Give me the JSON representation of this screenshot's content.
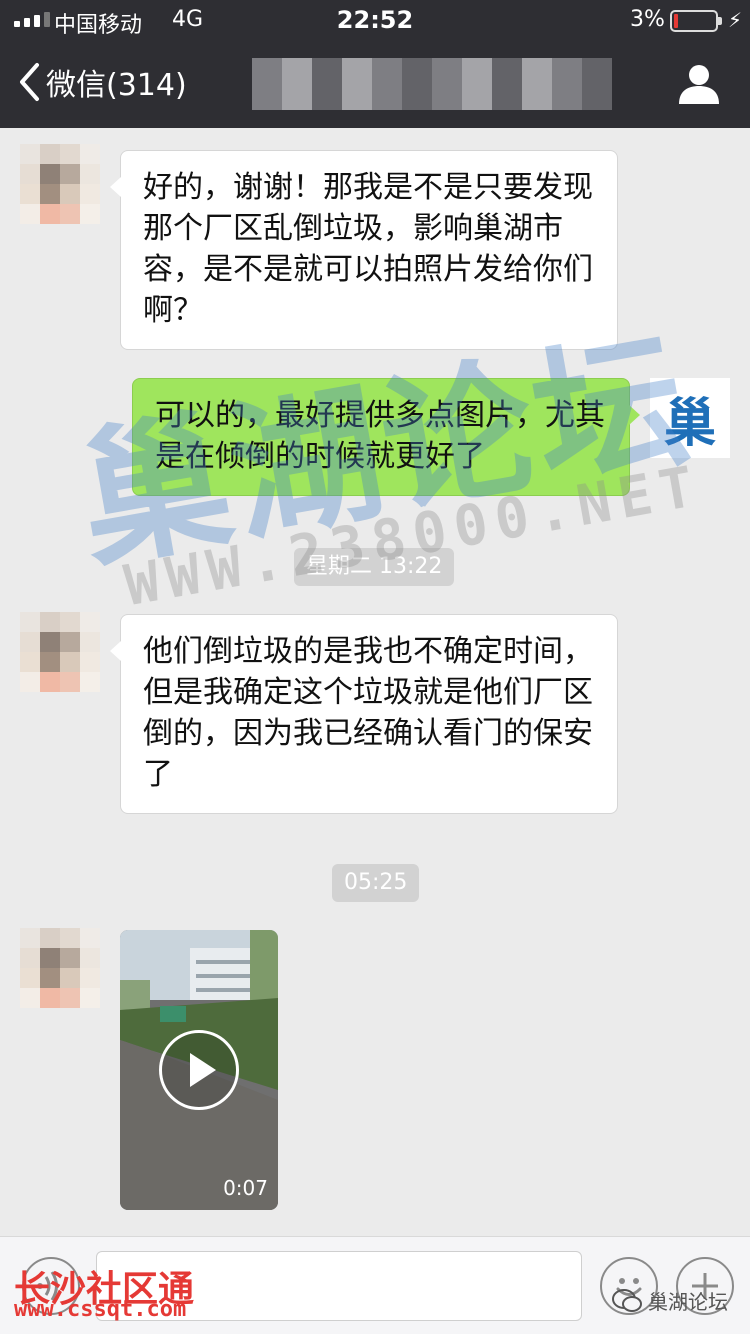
{
  "status_bar": {
    "carrier": "中国移动",
    "network": "4G",
    "time": "22:52",
    "battery_percent": "3%",
    "battery_level": 0.03
  },
  "nav": {
    "back_label": "微信(314)",
    "title": ""
  },
  "messages": [
    {
      "side": "in",
      "text": "好的，谢谢！那我是不是只要发现那个厂区乱倒垃圾，影响巢湖市容，是不是就可以拍照片发给你们啊？"
    },
    {
      "side": "out",
      "text": "可以的，最好提供多点图片，尤其是在倾倒的时候就更好了"
    },
    {
      "type": "time",
      "text": "星期二 13:22"
    },
    {
      "side": "in",
      "text": "他们倒垃圾的是我也不确定时间，但是我确定这个垃圾就是他们厂区倒的，因为我已经确认看门的保安了"
    },
    {
      "type": "time",
      "text": "05:25"
    },
    {
      "side": "in",
      "type": "video",
      "duration": "0:07"
    }
  ],
  "logo_avatar_char": "巢",
  "watermarks": {
    "main": "巢湖论坛",
    "url": "WWW.238000.NET",
    "source_name": "长沙社区通",
    "source_url": "www.cssqt.com",
    "wechat_account": "巢湖论坛"
  },
  "input": {
    "placeholder": ""
  },
  "colors": {
    "bar_bg": "#2e2e33",
    "chat_bg": "#ebebeb",
    "outgoing_bubble": "#9fe55d",
    "incoming_bubble": "#ffffff",
    "watermark_blue": "#4682c8",
    "source_red": "#e53935"
  },
  "icons": {
    "back": "chevron-left-icon",
    "profile": "person-icon",
    "play": "play-icon",
    "voice": "voice-icon",
    "emoji": "emoji-icon",
    "plus": "plus-icon"
  }
}
